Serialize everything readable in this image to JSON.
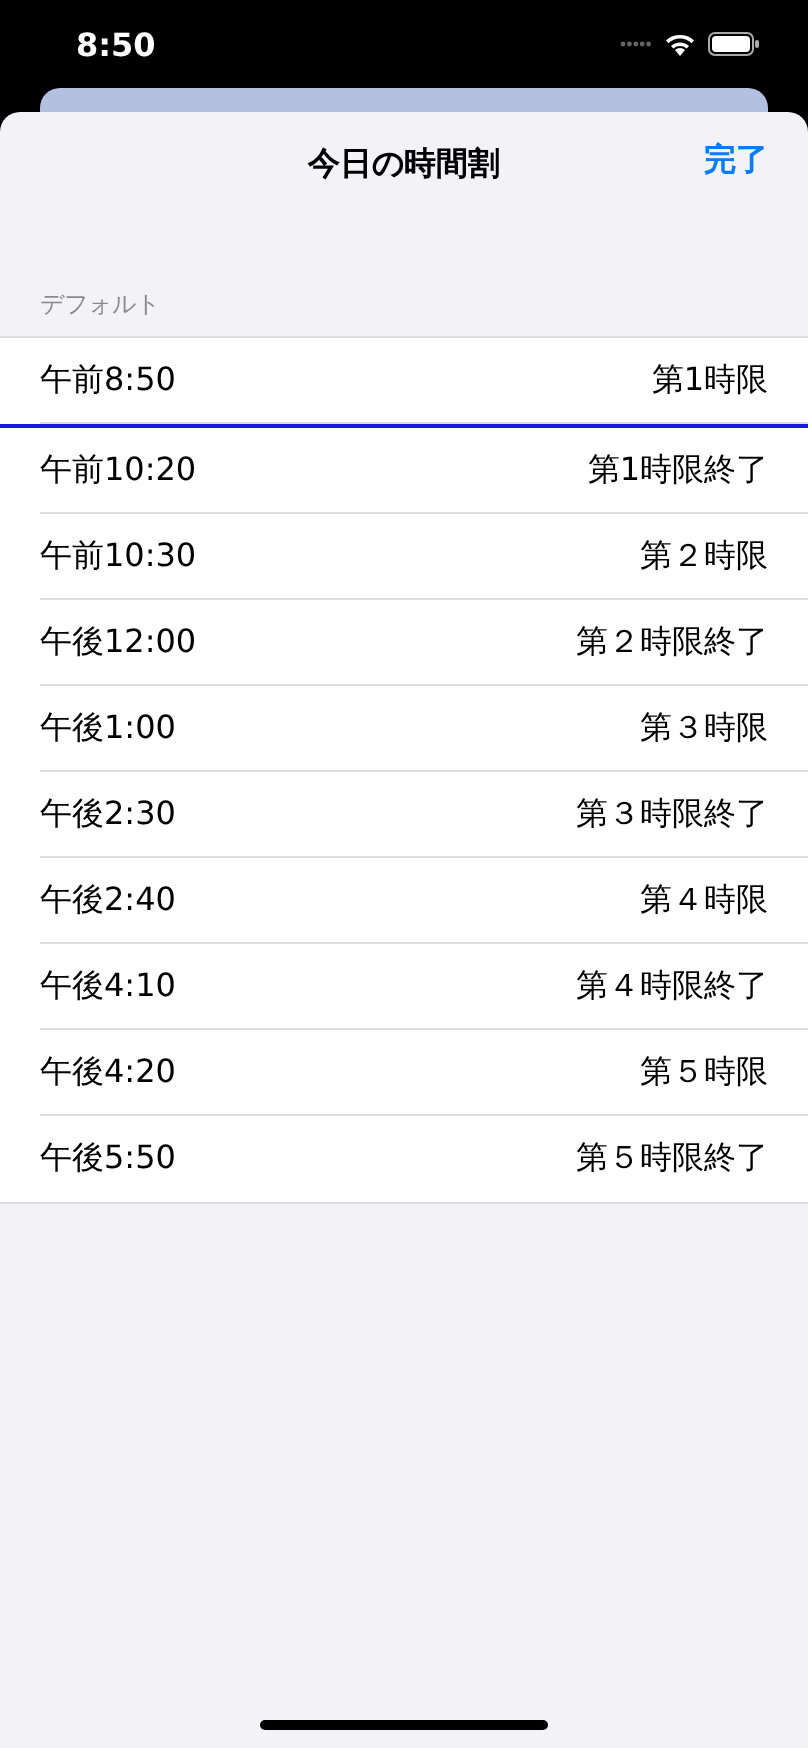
{
  "status_bar": {
    "time": "8:50"
  },
  "sheet": {
    "title": "今日の時間割",
    "done": "完了"
  },
  "section": {
    "header": "デフォルト"
  },
  "rows": [
    {
      "time": "午前8:50",
      "label": "第1時限",
      "current": true
    },
    {
      "time": "午前10:20",
      "label": "第1時限終了",
      "current": false
    },
    {
      "time": "午前10:30",
      "label": "第２時限",
      "current": false
    },
    {
      "time": "午後12:00",
      "label": "第２時限終了",
      "current": false
    },
    {
      "time": "午後1:00",
      "label": "第３時限",
      "current": false
    },
    {
      "time": "午後2:30",
      "label": "第３時限終了",
      "current": false
    },
    {
      "time": "午後2:40",
      "label": "第４時限",
      "current": false
    },
    {
      "time": "午後4:10",
      "label": "第４時限終了",
      "current": false
    },
    {
      "time": "午後4:20",
      "label": "第５時限",
      "current": false
    },
    {
      "time": "午後5:50",
      "label": "第５時限終了",
      "current": false
    }
  ]
}
